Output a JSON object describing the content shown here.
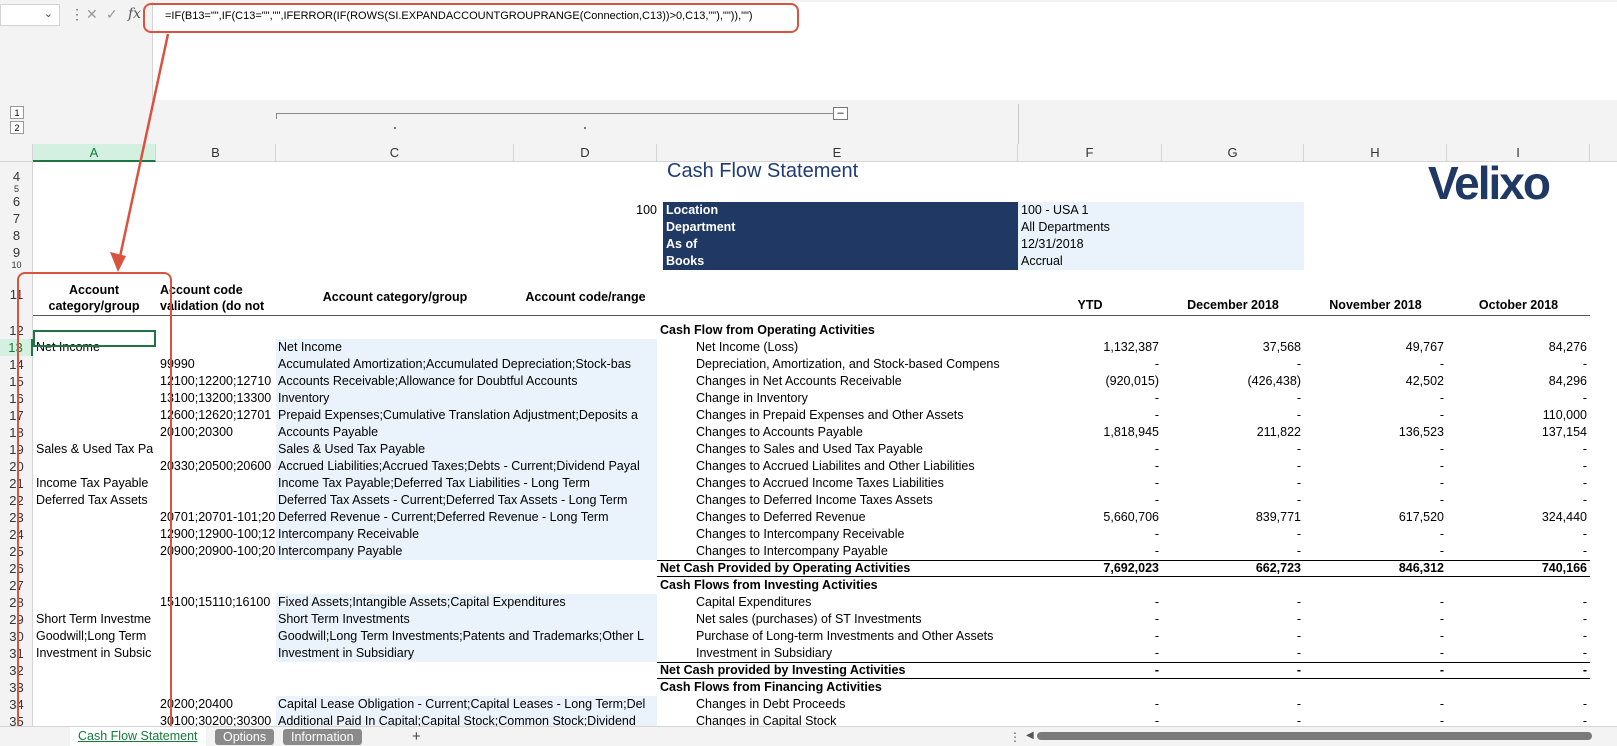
{
  "formula_bar": {
    "name_box": "",
    "fx_label": "fx",
    "formula": "=IF(B13=\"\",IF(C13=\"\",\"\",IFERROR(IF(ROWS(SI.EXPANDACCOUNTGROUPRANGE(Connection,C13))>0,C13,\"\"),\"\")),\"\")"
  },
  "outline": {
    "levels": [
      "1",
      "2"
    ],
    "collapse_label": "–"
  },
  "columns": [
    "A",
    "B",
    "C",
    "D",
    "E",
    "F",
    "G",
    "H",
    "I"
  ],
  "rows": [
    "4",
    "5",
    "6",
    "7",
    "8",
    "9",
    "10",
    "11",
    "12",
    "13",
    "14",
    "15",
    "16",
    "17",
    "18",
    "19",
    "20",
    "21",
    "22",
    "23",
    "24",
    "25",
    "26",
    "27",
    "28",
    "29",
    "30",
    "31",
    "32",
    "33",
    "34",
    "35"
  ],
  "report": {
    "title": "Cash Flow Statement",
    "logo": "Velixo",
    "location_code": "100",
    "params": [
      {
        "label": "Location",
        "value": "100 - USA 1"
      },
      {
        "label": "Department",
        "value": "All Departments"
      },
      {
        "label": "As of",
        "value": "12/31/2018"
      },
      {
        "label": "Books",
        "value": "Accrual"
      }
    ]
  },
  "headers": {
    "a": "Account category/group",
    "b": "Account code validation (do not",
    "c": "Account category/group",
    "d": "Account code/range",
    "ytd": "YTD",
    "dec": "December 2018",
    "nov": "November 2018",
    "oct": "October 2018"
  },
  "grid_rows": [
    {
      "a": "",
      "b": "",
      "c": "",
      "e": "Cash Flow from Operating Activities",
      "f": "",
      "g": "",
      "h": "",
      "i": "",
      "kind": "section"
    },
    {
      "a": "Net Income",
      "b": "",
      "c": "Net Income",
      "e": "Net Income (Loss)",
      "f": "1,132,387",
      "g": "37,568",
      "h": "49,767",
      "i": "84,276",
      "kind": "item"
    },
    {
      "a": "",
      "b": "99990",
      "c": "Accumulated Amortization;Accumulated Depreciation;Stock-bas",
      "e": "Depreciation, Amortization, and Stock-based Compens",
      "f": "-",
      "g": "-",
      "h": "-",
      "i": "-",
      "kind": "item"
    },
    {
      "a": "",
      "b": "12100;12200;12710",
      "c": "Accounts Receivable;Allowance for Doubtful Accounts",
      "e": "Changes in Net Accounts Receivable",
      "f": "(920,015)",
      "g": "(426,438)",
      "h": "42,502",
      "i": "84,296",
      "kind": "item"
    },
    {
      "a": "",
      "b": "13100;13200;13300",
      "c": "Inventory",
      "e": "Change in Inventory",
      "f": "-",
      "g": "-",
      "h": "-",
      "i": "-",
      "kind": "item"
    },
    {
      "a": "",
      "b": "12600;12620;12701",
      "c": "Prepaid Expenses;Cumulative Translation Adjustment;Deposits a",
      "e": "Changes in Prepaid Expenses and Other Assets",
      "f": "-",
      "g": "-",
      "h": "-",
      "i": "110,000",
      "kind": "item"
    },
    {
      "a": "",
      "b": "20100;20300",
      "c": "Accounts Payable",
      "e": "Changes to Accounts Payable",
      "f": "1,818,945",
      "g": "211,822",
      "h": "136,523",
      "i": "137,154",
      "kind": "item"
    },
    {
      "a": "Sales & Used Tax Pa",
      "b": "",
      "c": "Sales & Used Tax Payable",
      "e": "Changes to Sales and Used Tax Payable",
      "f": "-",
      "g": "-",
      "h": "-",
      "i": "-",
      "kind": "item"
    },
    {
      "a": "",
      "b": "20330;20500;20600",
      "c": "Accrued Liabilities;Accrued Taxes;Debts - Current;Dividend Payal",
      "e": "Changes to Accrued Liabilites and Other Liabilities",
      "f": "-",
      "g": "-",
      "h": "-",
      "i": "-",
      "kind": "item"
    },
    {
      "a": "Income Tax Payable",
      "b": "",
      "c": "Income Tax Payable;Deferred Tax Liabilities - Long Term",
      "e": "Changes to Accrued Income Taxes Liabilities",
      "f": "-",
      "g": "-",
      "h": "-",
      "i": "-",
      "kind": "item"
    },
    {
      "a": "Deferred Tax Assets",
      "b": "",
      "c": "Deferred Tax Assets - Current;Deferred Tax Assets - Long Term",
      "e": "Changes to Deferred Income Taxes Assets",
      "f": "-",
      "g": "-",
      "h": "-",
      "i": "-",
      "kind": "item"
    },
    {
      "a": "",
      "b": "20701;20701-101;20",
      "c": "Deferred Revenue - Current;Deferred Revenue - Long Term",
      "e": "Changes to Deferred Revenue",
      "f": "5,660,706",
      "g": "839,771",
      "h": "617,520",
      "i": "324,440",
      "kind": "item"
    },
    {
      "a": "",
      "b": "12900;12900-100;12",
      "c": "Intercompany Receivable",
      "e": "Changes to Intercompany Receivable",
      "f": "-",
      "g": "-",
      "h": "-",
      "i": "-",
      "kind": "item"
    },
    {
      "a": "",
      "b": "20900;20900-100;20",
      "c": "Intercompany Payable",
      "e": "Changes to Intercompany Payable",
      "f": "-",
      "g": "-",
      "h": "-",
      "i": "-",
      "kind": "item"
    },
    {
      "a": "",
      "b": "",
      "c": "",
      "e": "Net Cash Provided by Operating Activities",
      "f": "7,692,023",
      "g": "662,723",
      "h": "846,312",
      "i": "740,166",
      "kind": "total"
    },
    {
      "a": "",
      "b": "",
      "c": "",
      "e": "Cash Flows from Investing Activities",
      "f": "",
      "g": "",
      "h": "",
      "i": "",
      "kind": "section"
    },
    {
      "a": "",
      "b": "15100;15110;16100",
      "c": "Fixed Assets;Intangible Assets;Capital Expenditures",
      "e": "Capital Expenditures",
      "f": "-",
      "g": "-",
      "h": "-",
      "i": "-",
      "kind": "item"
    },
    {
      "a": "Short Term Investme",
      "b": "",
      "c": "Short Term Investments",
      "e": "Net sales (purchases) of ST Investments",
      "f": "-",
      "g": "-",
      "h": "-",
      "i": "-",
      "kind": "item"
    },
    {
      "a": "Goodwill;Long Term",
      "b": "",
      "c": "Goodwill;Long Term Investments;Patents and Trademarks;Other L",
      "e": "Purchase of Long-term Investments and Other Assets",
      "f": "-",
      "g": "-",
      "h": "-",
      "i": "-",
      "kind": "item"
    },
    {
      "a": "Investment in Subsic",
      "b": "",
      "c": "Investment in Subsidiary",
      "e": "Investment in Subsidiary",
      "f": "-",
      "g": "-",
      "h": "-",
      "i": "-",
      "kind": "item"
    },
    {
      "a": "",
      "b": "",
      "c": "",
      "e": "Net Cash provided by Investing Activities",
      "f": "-",
      "g": "-",
      "h": "-",
      "i": "-",
      "kind": "total"
    },
    {
      "a": "",
      "b": "",
      "c": "",
      "e": "Cash Flows from Financing Activities",
      "f": "",
      "g": "",
      "h": "",
      "i": "",
      "kind": "section"
    },
    {
      "a": "",
      "b": "20200;20400",
      "c": "Capital Lease Obligation - Current;Capital Leases - Long Term;Del",
      "e": "Changes in Debt Proceeds",
      "f": "-",
      "g": "-",
      "h": "-",
      "i": "-",
      "kind": "item"
    },
    {
      "a": "",
      "b": "30100;30200;30300",
      "c": "Additional Paid In Capital;Capital Stock;Common Stock;Dividend",
      "e": "Changes in Capital Stock",
      "f": "-",
      "g": "-",
      "h": "-",
      "i": "-",
      "kind": "item"
    }
  ],
  "sheet_tabs": [
    "Cash Flow Statement",
    "Options",
    "Information"
  ],
  "add_sheet_label": "+"
}
